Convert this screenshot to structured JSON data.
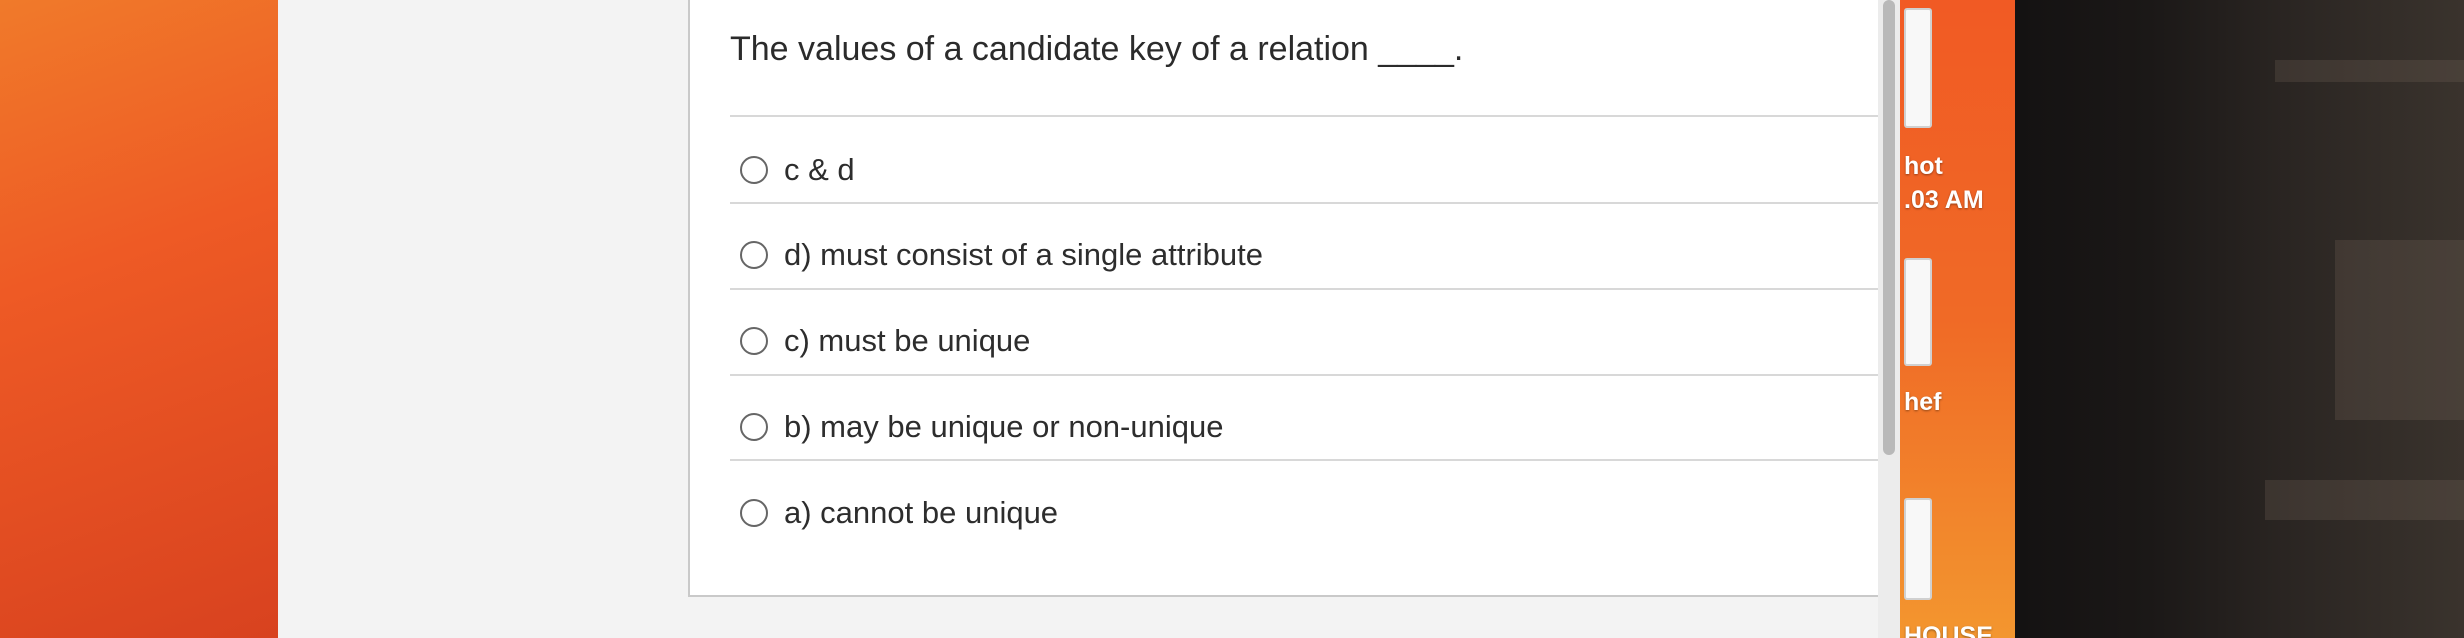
{
  "quiz": {
    "question": "The values of a candidate key of a relation ____.",
    "answers": [
      {
        "label": "c & d"
      },
      {
        "label": "d) must consist of a single attribute"
      },
      {
        "label": "c) must be unique"
      },
      {
        "label": "b) may be unique or non-unique"
      },
      {
        "label": "a) cannot be unique"
      }
    ]
  },
  "desktop": {
    "label_1": "hot",
    "label_2": ".03 AM",
    "label_3": "hef",
    "label_4": "HOUSE"
  },
  "colors": {
    "desktop_orange": "#f15a24",
    "card_background": "#ffffff",
    "text": "#2b2b2b"
  }
}
